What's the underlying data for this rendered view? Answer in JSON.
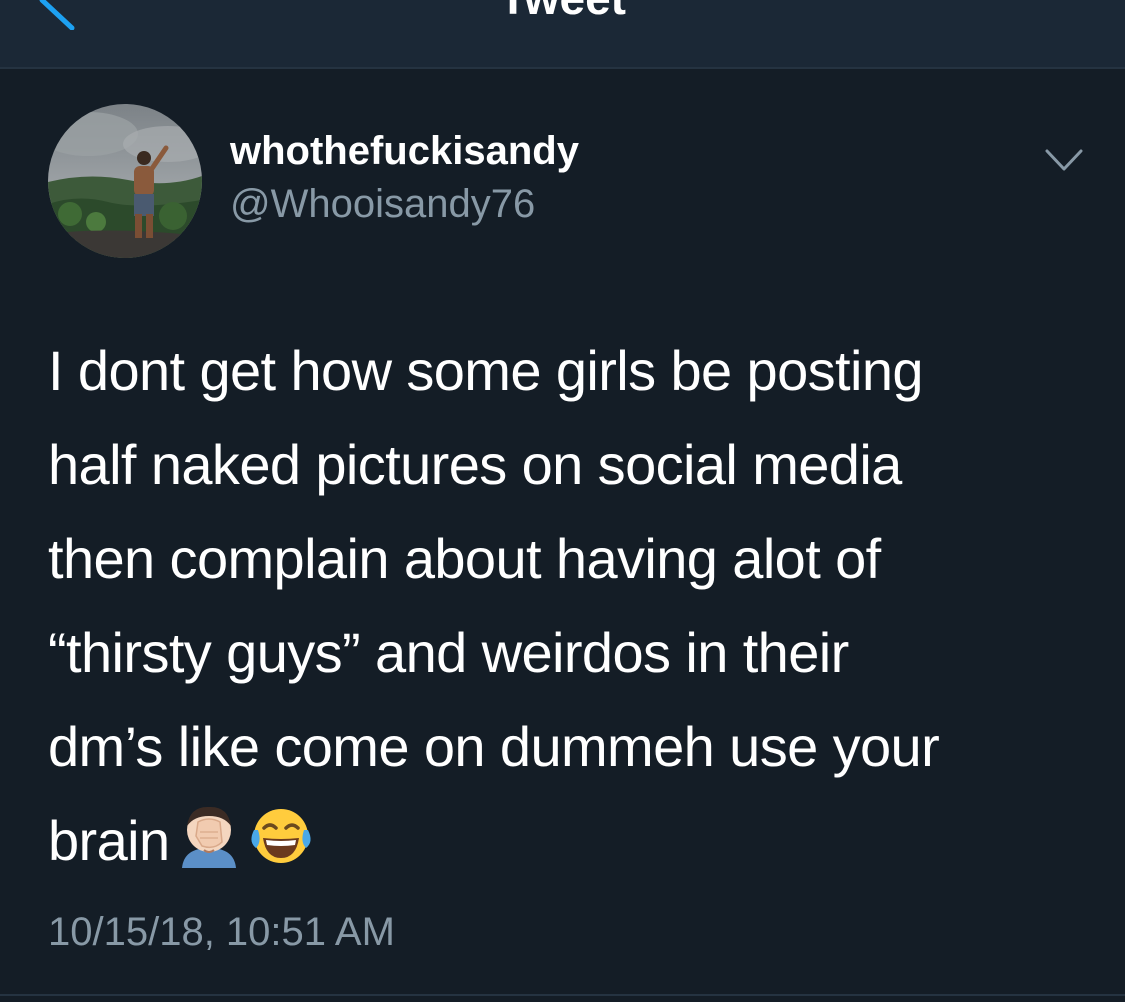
{
  "header": {
    "title": "Tweet",
    "back_icon": "chevron-left-icon"
  },
  "tweet": {
    "author": {
      "display_name": "whothefuckisandy",
      "handle": "@Whooisandy76"
    },
    "text": "I dont get how some girls be posting\nhalf naked pictures on social media\nthen complain about having alot of\n“thirsty guys” and weirdos in their\ndm’s like come on dummeh use your\nbrain",
    "emojis": [
      "face-palm-emoji",
      "tears-of-joy-emoji"
    ],
    "timestamp": "10/15/18, 10:51 AM"
  },
  "colors": {
    "background": "#141d26",
    "header_background": "#1b2836",
    "primary_text": "#ffffff",
    "secondary_text": "#8899a6",
    "accent": "#1da1f2",
    "divider": "#253341"
  }
}
